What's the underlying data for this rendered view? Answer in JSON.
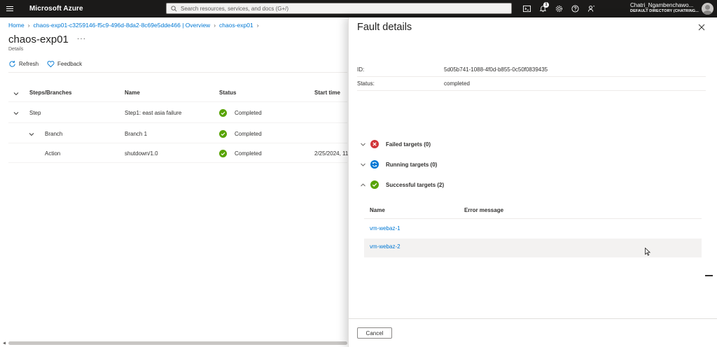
{
  "topbar": {
    "brand": "Microsoft Azure",
    "search_placeholder": "Search resources, services, and docs (G+/)",
    "notification_count": "1",
    "account_name": "Chatri_Ngambenchawo...",
    "account_directory": "DEFAULT DIRECTORY (CHATRING...",
    "icons": [
      "terminal-icon",
      "bell-icon",
      "gear-icon",
      "help-icon",
      "feedback-icon"
    ]
  },
  "breadcrumb": {
    "items": [
      "Home",
      "chaos-exp01-c3259146-f5c9-496d-8da2-8c69e5dde466 | Overview",
      "chaos-exp01"
    ]
  },
  "page": {
    "title": "chaos-exp01",
    "subtitle": "Details",
    "more": "···"
  },
  "commands": {
    "refresh": "Refresh",
    "feedback": "Feedback"
  },
  "grid": {
    "columns": [
      "Steps/Branches",
      "Name",
      "Status",
      "Start time"
    ],
    "rows": [
      {
        "level": "Step",
        "name": "Step1: east asia failure",
        "status": "Completed",
        "start": ""
      },
      {
        "level": "Branch",
        "name": "Branch 1",
        "status": "Completed",
        "start": ""
      },
      {
        "level": "Action",
        "name": "shutdown/1.0",
        "status": "Completed",
        "start": "2/25/2024, 11"
      }
    ]
  },
  "panel": {
    "title": "Fault details",
    "id_label": "ID:",
    "id_value": "5d05b741-1088-4f0d-b855-0c50f0839435",
    "status_label": "Status:",
    "status_value": "completed",
    "sections": {
      "failed": "Failed targets (0)",
      "running": "Running targets (0)",
      "successful": "Successful targets (2)"
    },
    "table": {
      "columns": [
        "Name",
        "Error message"
      ],
      "rows": [
        "vm-webaz-1",
        "vm-webaz-2"
      ]
    },
    "cancel_label": "Cancel"
  },
  "colors": {
    "topbar": "#1b1a19",
    "link": "#0078d4",
    "success": "#57a300",
    "error": "#d13438",
    "running": "#0078d4"
  }
}
